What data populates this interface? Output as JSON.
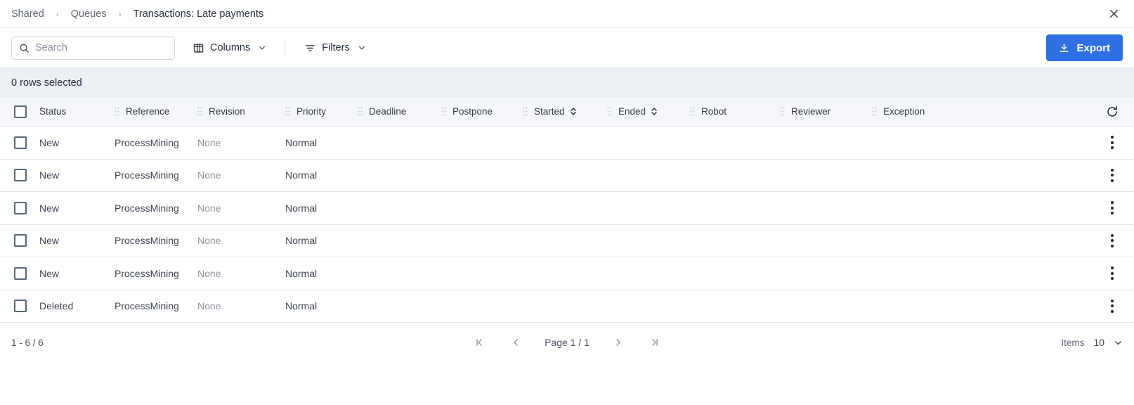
{
  "breadcrumb": {
    "items": [
      {
        "label": "Shared",
        "current": false
      },
      {
        "label": "Queues",
        "current": false
      },
      {
        "label": "Transactions: Late payments",
        "current": true
      }
    ],
    "separator": "›",
    "close_icon": "close-icon"
  },
  "toolbar": {
    "search": {
      "placeholder": "Search",
      "value": "",
      "icon": "search-icon"
    },
    "columns": {
      "label": "Columns",
      "icon": "columns-icon",
      "chevron": "chevron-down-icon"
    },
    "filters": {
      "label": "Filters",
      "icon": "filter-icon",
      "chevron": "chevron-down-icon"
    },
    "export": {
      "label": "Export",
      "icon": "download-icon",
      "color": "#2f6fe4"
    }
  },
  "selection": {
    "text": "0 rows selected"
  },
  "table": {
    "columns": [
      {
        "key": "status",
        "label": "Status",
        "sortable": false,
        "grip": false
      },
      {
        "key": "reference",
        "label": "Reference",
        "sortable": false,
        "grip": true
      },
      {
        "key": "revision",
        "label": "Revision",
        "sortable": false,
        "grip": true
      },
      {
        "key": "priority",
        "label": "Priority",
        "sortable": false,
        "grip": true
      },
      {
        "key": "deadline",
        "label": "Deadline",
        "sortable": false,
        "grip": true
      },
      {
        "key": "postpone",
        "label": "Postpone",
        "sortable": false,
        "grip": true
      },
      {
        "key": "started",
        "label": "Started",
        "sortable": true,
        "grip": true
      },
      {
        "key": "ended",
        "label": "Ended",
        "sortable": true,
        "grip": true
      },
      {
        "key": "robot",
        "label": "Robot",
        "sortable": false,
        "grip": true
      },
      {
        "key": "reviewer",
        "label": "Reviewer",
        "sortable": false,
        "grip": true
      },
      {
        "key": "exception",
        "label": "Exception",
        "sortable": false,
        "grip": true
      }
    ],
    "refresh_icon": "refresh-icon",
    "row_menu_icon": "kebab-menu-icon",
    "rows": [
      {
        "checked": false,
        "status": "New",
        "reference": "ProcessMining",
        "revision": "None",
        "priority": "Normal",
        "deadline": "",
        "postpone": "",
        "started": "",
        "ended": "",
        "robot": "",
        "reviewer": "",
        "exception": ""
      },
      {
        "checked": false,
        "status": "New",
        "reference": "ProcessMining",
        "revision": "None",
        "priority": "Normal",
        "deadline": "",
        "postpone": "",
        "started": "",
        "ended": "",
        "robot": "",
        "reviewer": "",
        "exception": ""
      },
      {
        "checked": false,
        "status": "New",
        "reference": "ProcessMining",
        "revision": "None",
        "priority": "Normal",
        "deadline": "",
        "postpone": "",
        "started": "",
        "ended": "",
        "robot": "",
        "reviewer": "",
        "exception": ""
      },
      {
        "checked": false,
        "status": "New",
        "reference": "ProcessMining",
        "revision": "None",
        "priority": "Normal",
        "deadline": "",
        "postpone": "",
        "started": "",
        "ended": "",
        "robot": "",
        "reviewer": "",
        "exception": ""
      },
      {
        "checked": false,
        "status": "New",
        "reference": "ProcessMining",
        "revision": "None",
        "priority": "Normal",
        "deadline": "",
        "postpone": "",
        "started": "",
        "ended": "",
        "robot": "",
        "reviewer": "",
        "exception": ""
      },
      {
        "checked": false,
        "status": "Deleted",
        "reference": "ProcessMining",
        "revision": "None",
        "priority": "Normal",
        "deadline": "",
        "postpone": "",
        "started": "",
        "ended": "",
        "robot": "",
        "reviewer": "",
        "exception": ""
      }
    ]
  },
  "footer": {
    "range": "1 - 6 / 6",
    "pager": {
      "first": "⏮",
      "prev": "‹",
      "label": "Page 1 / 1",
      "next": "›",
      "last": "⏭"
    },
    "items": {
      "label": "Items",
      "value": "10",
      "chevron": "chevron-down-icon"
    }
  }
}
